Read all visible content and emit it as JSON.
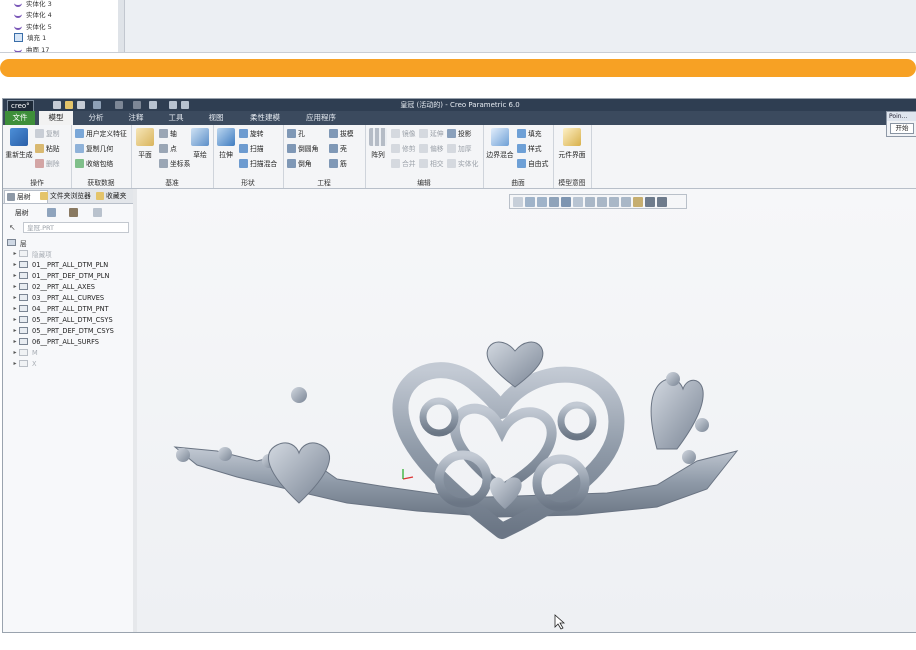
{
  "previous_screen": {
    "tree_items": [
      {
        "label": "实体化 3",
        "icon": "swept-feature-icon"
      },
      {
        "label": "实体化 4",
        "icon": "swept-feature-icon"
      },
      {
        "label": "实体化 5",
        "icon": "swept-feature-icon"
      },
      {
        "label": "填充 1",
        "icon": "fill-icon"
      },
      {
        "label": "曲面 17",
        "icon": "surface-icon"
      }
    ]
  },
  "divider": {
    "color": "#f7a124"
  },
  "window": {
    "logo": "creo°",
    "title": "皇冠 (活动的) - Creo Parametric 6.0"
  },
  "menu_tabs": [
    "文件",
    "模型",
    "分析",
    "注释",
    "工具",
    "视图",
    "柔性建模",
    "应用程序"
  ],
  "active_tab": "模型",
  "ribbon": {
    "operations": {
      "regenerate": "重新生成",
      "copy": "复制",
      "paste": "粘贴",
      "delete": "删除",
      "label": "操作"
    },
    "get_data": {
      "udf": "用户定义特征",
      "copy_geom": "复制几何",
      "shrinkwrap": "收缩包络",
      "label": "获取数据"
    },
    "datum": {
      "plane": "平面",
      "axis": "轴",
      "point": "点",
      "csys": "坐标系",
      "sketch": "草绘",
      "label": "基准"
    },
    "shapes": {
      "extrude": "拉伸",
      "revolve": "旋转",
      "sweep": "扫描",
      "swept_blend": "扫描混合",
      "label": "形状"
    },
    "engineering": {
      "hole": "孔",
      "round": "倒圆角",
      "chamfer": "倒角",
      "draft": "拔模",
      "shell": "壳",
      "rib": "筋",
      "label": "工程"
    },
    "editing": {
      "pattern": "阵列",
      "mirror": "镜像",
      "extend": "延伸",
      "project": "投影",
      "trim": "修剪",
      "offset": "偏移",
      "thicken": "加厚",
      "merge": "合并",
      "intersect": "相交",
      "solidify": "实体化",
      "label": "编辑"
    },
    "surfaces": {
      "boundary_blend": "边界混合",
      "fill": "填充",
      "style": "样式",
      "freestyle": "自由式",
      "label": "曲面"
    },
    "model_intent": {
      "component_interface": "元件界面",
      "label": "模型意图"
    }
  },
  "side_panel": {
    "tabs": [
      "层树",
      "文件夹浏览器",
      "收藏夹"
    ],
    "toolbar_label": "层树",
    "search_value": "皇冠.PRT",
    "root": "层",
    "layers": [
      {
        "label": "隐藏项",
        "dim": true
      },
      {
        "label": "01__PRT_ALL_DTM_PLN",
        "dim": false
      },
      {
        "label": "01__PRT_DEF_DTM_PLN",
        "dim": false
      },
      {
        "label": "02__PRT_ALL_AXES",
        "dim": false
      },
      {
        "label": "03__PRT_ALL_CURVES",
        "dim": false
      },
      {
        "label": "04__PRT_ALL_DTM_PNT",
        "dim": false
      },
      {
        "label": "05__PRT_ALL_DTM_CSYS",
        "dim": false
      },
      {
        "label": "05__PRT_DEF_DTM_CSYS",
        "dim": false
      },
      {
        "label": "06__PRT_ALL_SURFS",
        "dim": false
      },
      {
        "label": "M",
        "dim": true
      },
      {
        "label": "X",
        "dim": true
      }
    ]
  },
  "point_dialog": {
    "title": "Poin...",
    "start_button": "开始"
  },
  "model": {
    "name": "皇冠",
    "color": "#8f9aa8"
  }
}
